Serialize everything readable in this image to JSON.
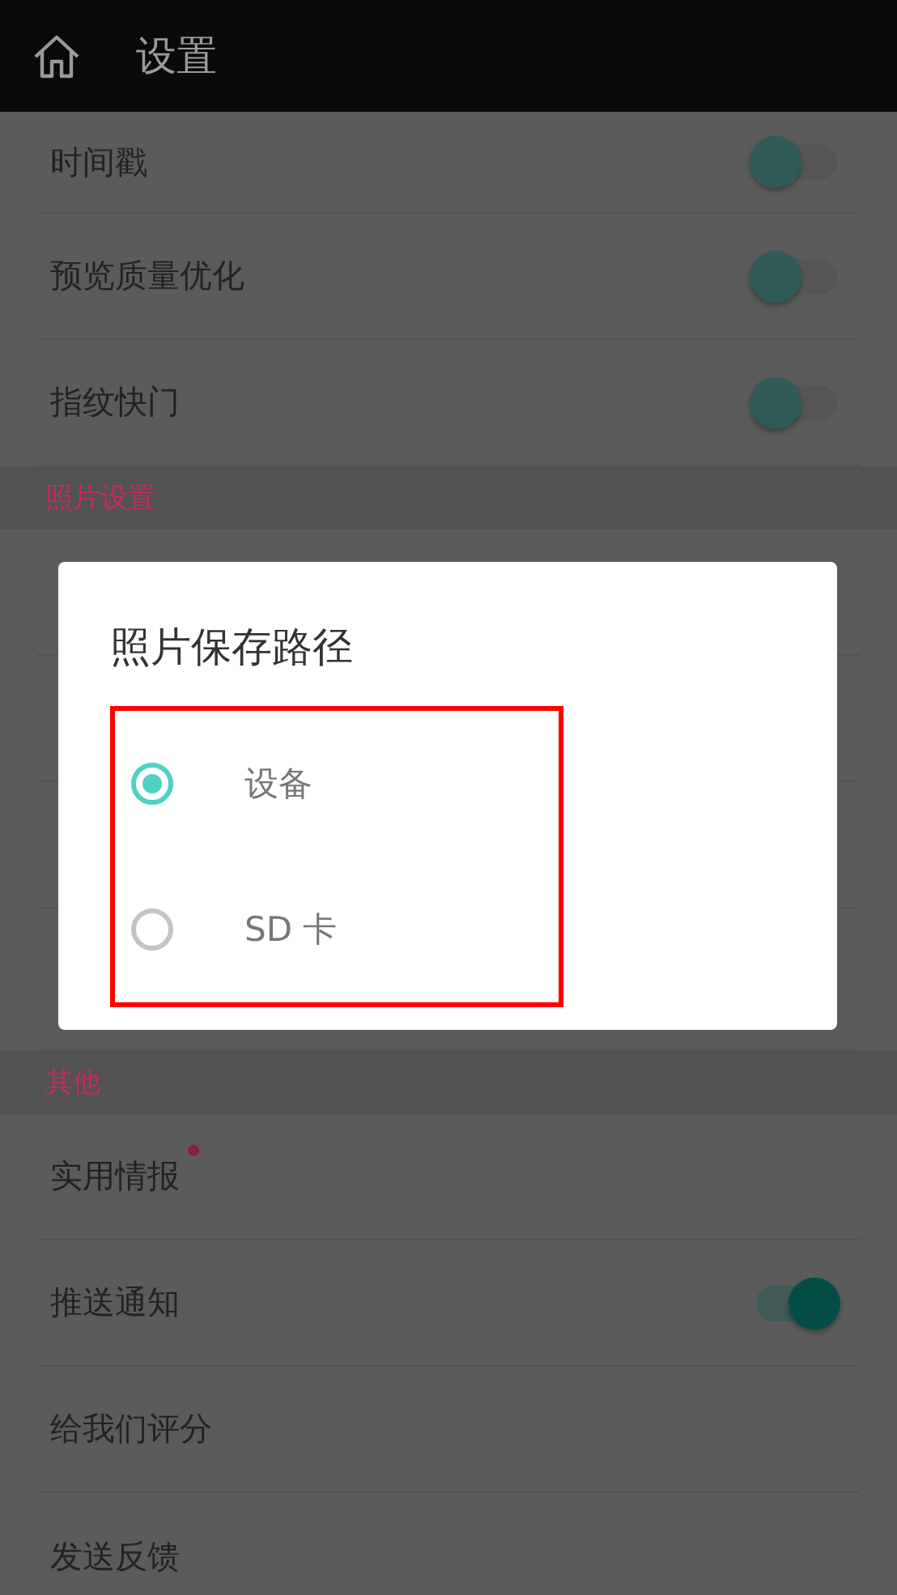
{
  "app_bar": {
    "title": "设置"
  },
  "sections": [
    {
      "rows": [
        {
          "kind": "toggle",
          "label": "时间戳",
          "on": false,
          "clipped_top": true
        },
        {
          "kind": "toggle",
          "label": "预览质量优化",
          "on": false
        },
        {
          "kind": "toggle",
          "label": "指纹快门",
          "on": false
        }
      ]
    },
    {
      "header": "照片设置",
      "rows": [
        {
          "kind": "hidden"
        },
        {
          "kind": "hidden"
        },
        {
          "kind": "hidden"
        },
        {
          "kind": "hidden_tall"
        }
      ]
    },
    {
      "header": "其他",
      "rows": [
        {
          "kind": "link",
          "label": "实用情报",
          "new_dot": true
        },
        {
          "kind": "toggle",
          "label": "推送通知",
          "on": true
        },
        {
          "kind": "link",
          "label": "给我们评分",
          "new_dot": false
        },
        {
          "kind": "link",
          "label": "发送反馈",
          "new_dot": false
        }
      ]
    }
  ],
  "dialog": {
    "title": "照片保存路径",
    "highlighted": true,
    "options": [
      {
        "label": "设备",
        "selected": true
      },
      {
        "label": "SD 卡",
        "selected": false
      }
    ]
  }
}
